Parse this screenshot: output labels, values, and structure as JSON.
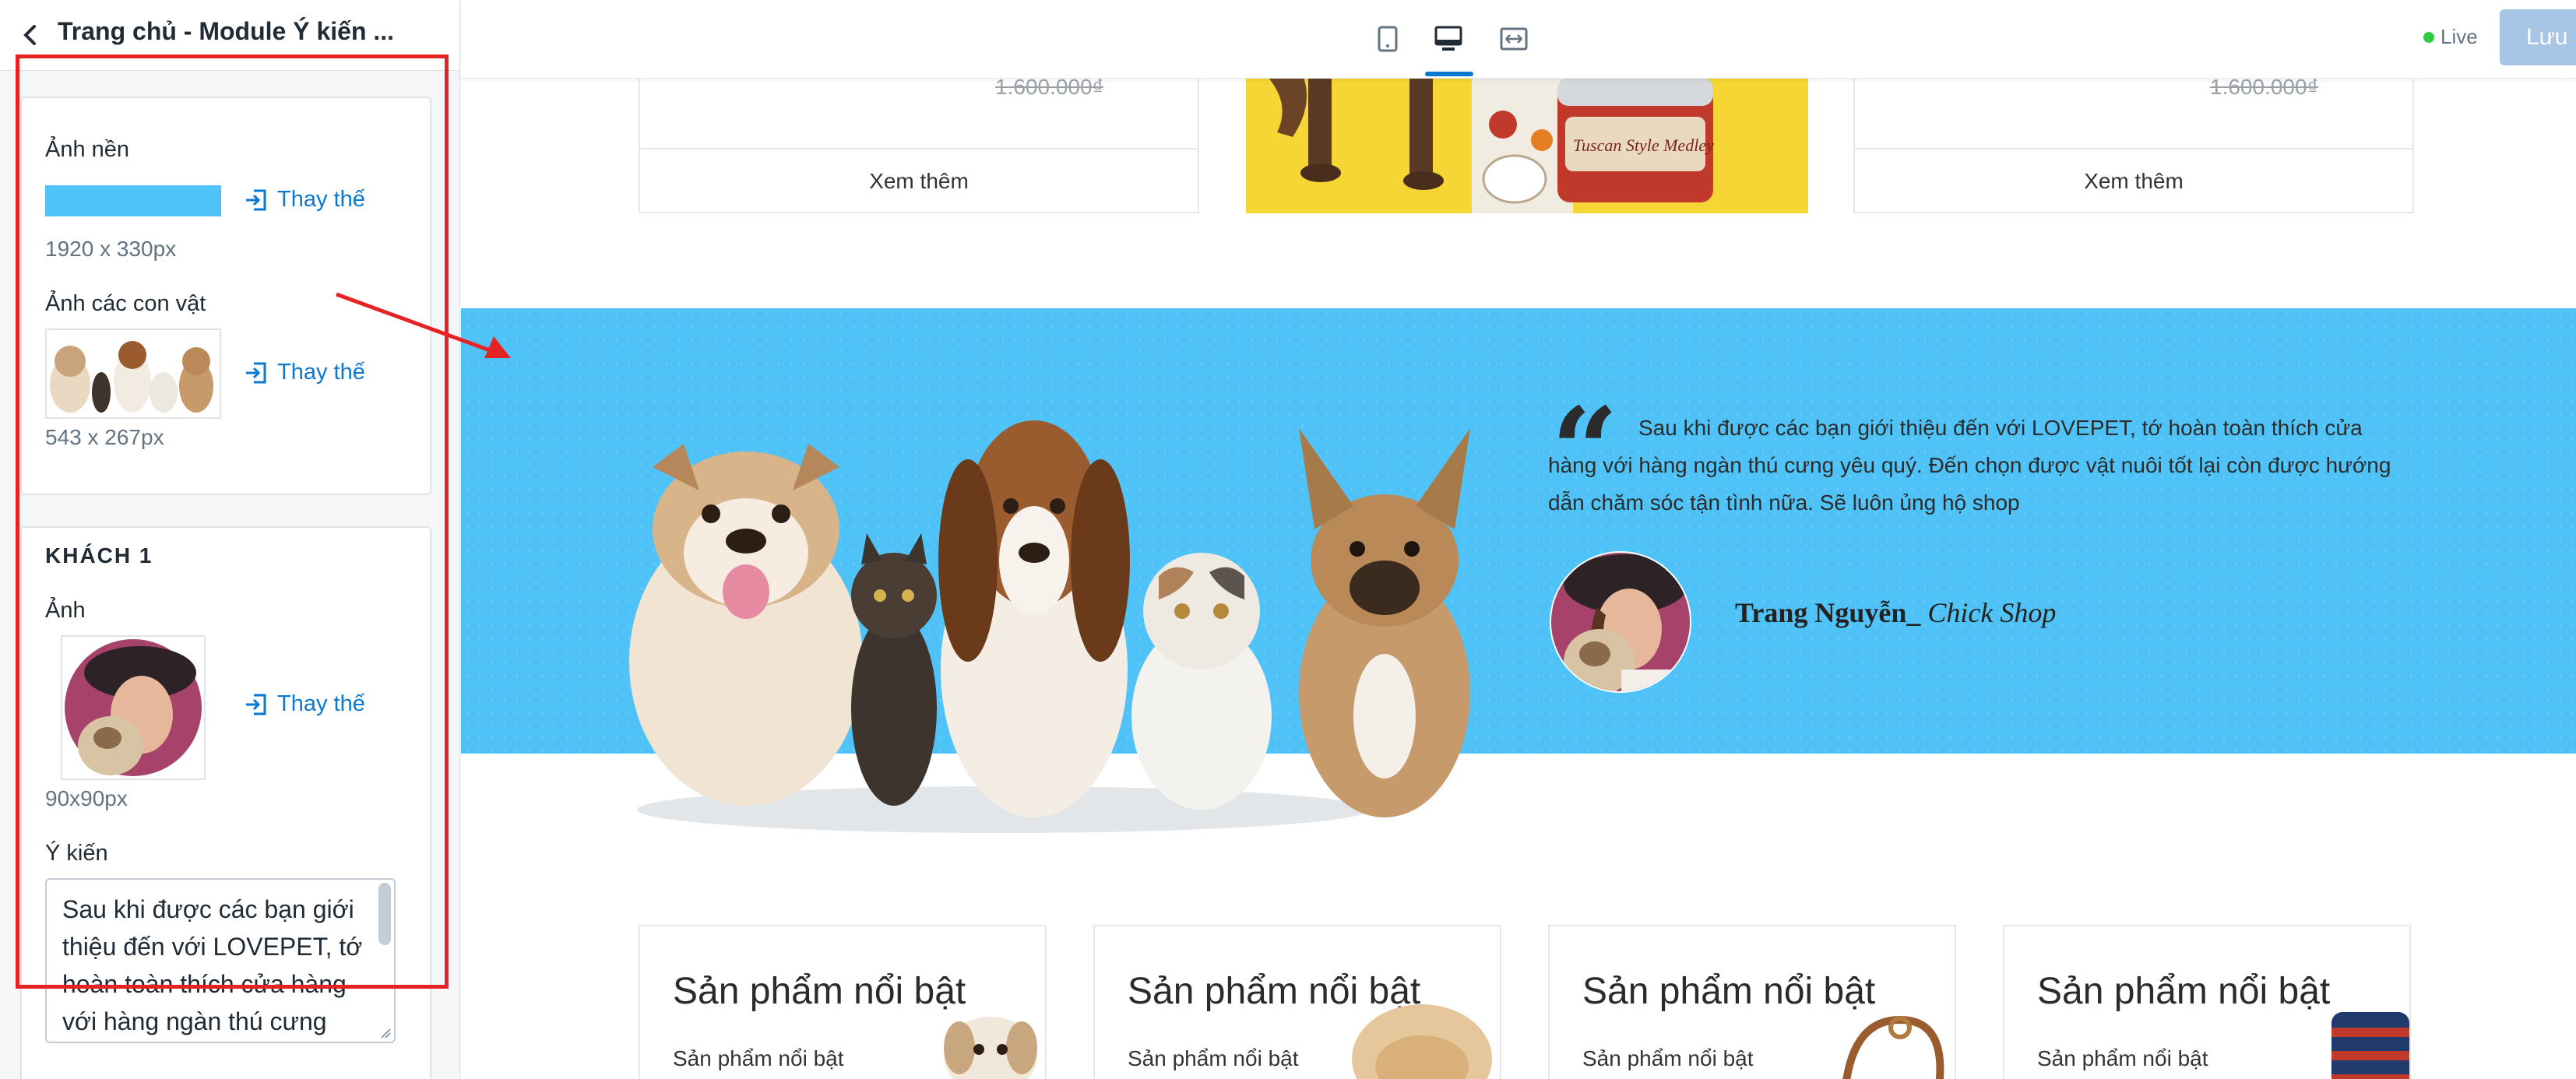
{
  "panel": {
    "title": "Trang chủ - Module Ý kiến ...",
    "background_image": {
      "label": "Ảnh nền",
      "replace_label": "Thay thế",
      "size_hint": "1920 x 330px",
      "swatch_color": "#4fc3f7"
    },
    "animals_image": {
      "label": "Ảnh các con vật",
      "replace_label": "Thay thế",
      "size_hint": "543 x 267px"
    },
    "customer1": {
      "section_title": "KHÁCH 1",
      "image_label": "Ảnh",
      "replace_label": "Thay thế",
      "size_hint": "90x90px",
      "opinion_label": "Ý kiến",
      "opinion_value": "Sau khi được các bạn giới thiệu đến với LOVEPET, tớ hoàn toàn thích cửa hàng với hàng ngàn thú cưng yêu quý."
    }
  },
  "toolbar": {
    "devices": [
      "mobile-icon",
      "desktop-icon",
      "fullwidth-icon"
    ],
    "active_device": "desktop-icon",
    "status_label": "Live",
    "save_label": "Lưu"
  },
  "preview": {
    "top_cards": [
      {
        "old_price": "1.600.000₫",
        "button": "Xem thêm"
      },
      {
        "old_price": "1.600.000₫",
        "button": "Xem thêm"
      }
    ],
    "testimonial": {
      "quote_mark": "“",
      "text": "Sau khi được các bạn giới thiệu đến với LOVEPET, tớ hoàn toàn thích cửa hàng với hàng ngàn thú cưng yêu quý. Đến chọn được vật nuôi tốt lại còn được hướng dẫn chăm sóc tận tình nữa. Sẽ luôn ủng hộ shop",
      "author_name": "Trang Nguyễn_",
      "author_shop": "Chick Shop",
      "background_color": "#4fc3f7"
    },
    "products": [
      {
        "title": "Sản phẩm nổi bật",
        "subtitle": "Sản phẩm nổi bật"
      },
      {
        "title": "Sản phẩm nổi bật",
        "subtitle": "Sản phẩm nổi bật"
      },
      {
        "title": "Sản phẩm nổi bật",
        "subtitle": "Sản phẩm nổi bật"
      },
      {
        "title": "Sản phẩm nổi bật",
        "subtitle": "Sản phẩm nổi bật"
      }
    ],
    "promo_can_label": "Tuscan Style Medley"
  },
  "colors": {
    "accent": "#0a79d1",
    "annotation_red": "#e62323",
    "live_green": "#2ecc40",
    "save_disabled": "#a7c5e5"
  }
}
